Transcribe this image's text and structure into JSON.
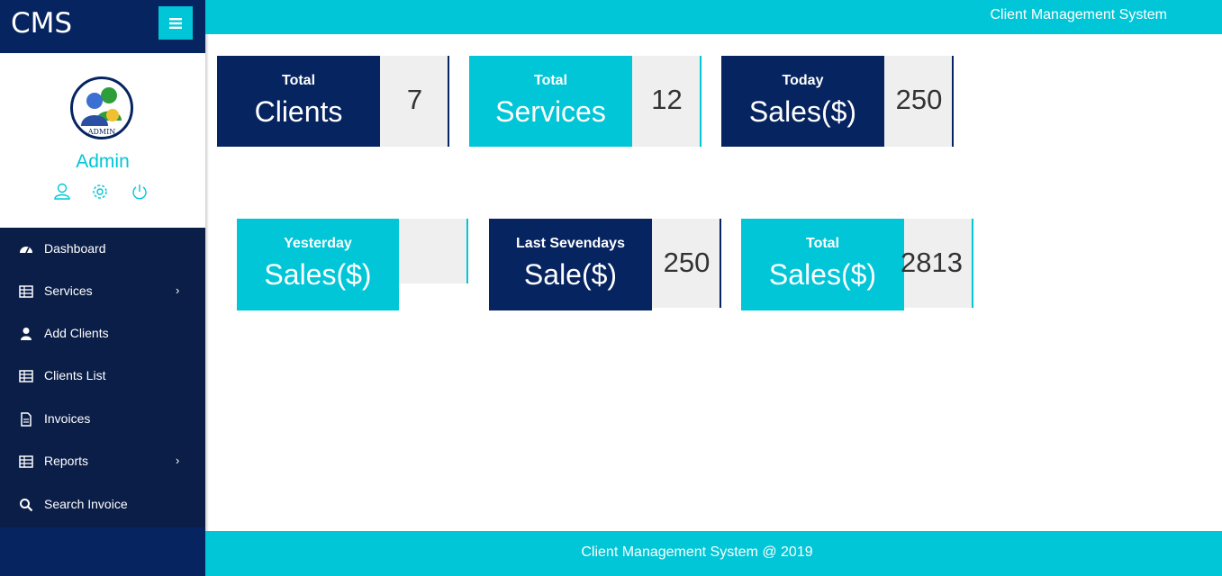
{
  "brand": {
    "title": "CMS",
    "menu_icon": "hamburger-icon"
  },
  "header": {
    "title": "Client Management System"
  },
  "profile": {
    "name": "Admin",
    "avatar_text": "ADMIN",
    "icons": [
      "user-icon",
      "gear-icon",
      "power-icon"
    ]
  },
  "nav": {
    "items": [
      {
        "label": "Dashboard",
        "icon": "dashboard-icon",
        "has_submenu": false
      },
      {
        "label": "Services",
        "icon": "table-icon",
        "has_submenu": true
      },
      {
        "label": "Add Clients",
        "icon": "user-icon",
        "has_submenu": false
      },
      {
        "label": "Clients List",
        "icon": "table-icon",
        "has_submenu": false
      },
      {
        "label": "Invoices",
        "icon": "file-icon",
        "has_submenu": false
      },
      {
        "label": "Reports",
        "icon": "table-icon",
        "has_submenu": true
      },
      {
        "label": "Search Invoice",
        "icon": "search-icon",
        "has_submenu": false
      }
    ],
    "chevron": "›"
  },
  "cards": [
    {
      "small": "Total",
      "big": "Clients",
      "value": "7",
      "color": "#062460"
    },
    {
      "small": "Total",
      "big": "Services",
      "value": "12",
      "color": "#00c6d7"
    },
    {
      "small": "Today",
      "big": "Sales($)",
      "value": "250",
      "color": "#062460"
    },
    {
      "small": "Yesterday",
      "big": "Sales($)",
      "value": "",
      "color": "#00c6d7"
    },
    {
      "small": "Last Sevendays",
      "big": "Sale($)",
      "value": "250",
      "color": "#062460"
    },
    {
      "small": "Total",
      "big": "Sales($)",
      "value": "2813",
      "color": "#00c6d7"
    }
  ],
  "footer": {
    "text": "Client Management System @ 2019"
  },
  "colors": {
    "primary_dark": "#062460",
    "accent": "#00c6d7",
    "nav_bg": "#0b1e48",
    "value_bg": "#efefef"
  }
}
